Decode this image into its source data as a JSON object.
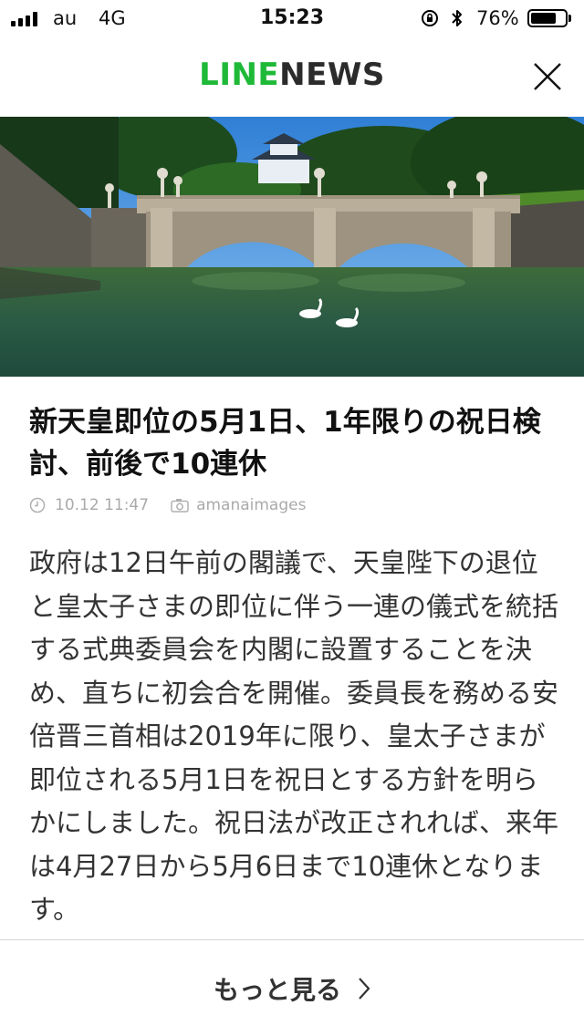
{
  "status_bar": {
    "carrier": "au",
    "network": "4G",
    "time": "15:23",
    "battery_percent": "76%",
    "battery_level": 0.76,
    "icons": [
      "signal-icon",
      "rotation-lock-icon",
      "bluetooth-icon",
      "battery-icon"
    ]
  },
  "header": {
    "logo_line": "LINE",
    "logo_news": "NEWS",
    "brand_color": "#1fb938",
    "close_icon": "close-icon"
  },
  "article": {
    "headline": "新天皇即位の5月1日、1年限りの祝日検討、前後で10連休",
    "timestamp": "10.12 11:47",
    "photo_credit": "amanaimages",
    "body": "政府は12日午前の閣議で、天皇陛下の退位と皇太子さまの即位に伴う一連の儀式を統括する式典委員会を内閣に設置することを決め、直ちに初会合を開催。委員長を務める安倍晋三首相は2019年に限り、皇太子さまが即位される5月1日を祝日とする方針を明らかにしました。祝日法が改正されれば、来年は4月27日から5月6日まで10連休となります。"
  },
  "footer": {
    "more_label": "もっと見る"
  }
}
